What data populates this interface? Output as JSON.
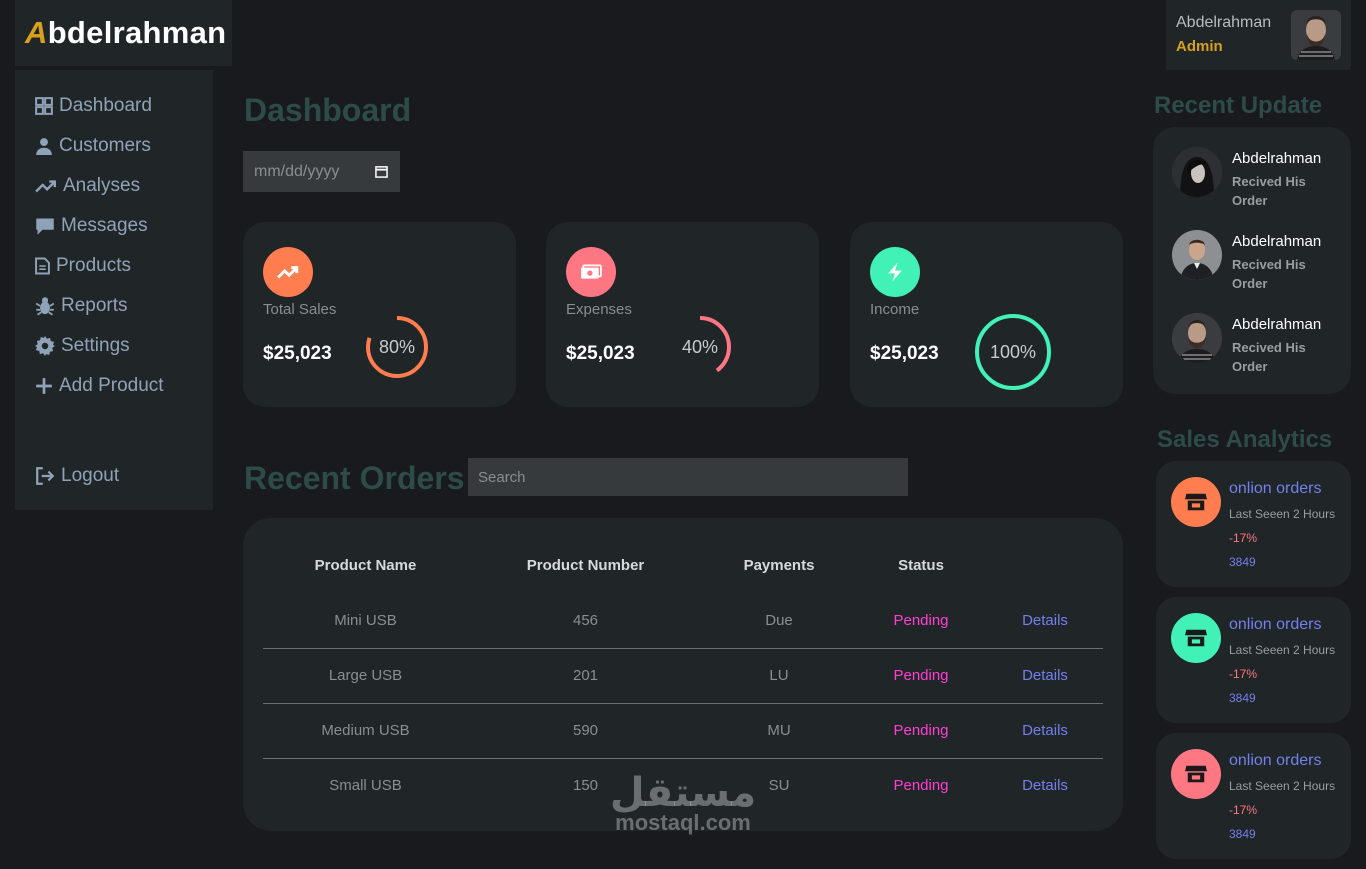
{
  "brand": {
    "first_letter": "A",
    "rest": "bdelrahman",
    "accent_color": "#d6a11c"
  },
  "topbar": {
    "user_name": "Abdelrahman",
    "user_role": "Admin"
  },
  "sidebar": {
    "items": [
      {
        "label": "Dashboard",
        "icon": "grid-icon"
      },
      {
        "label": "Customers",
        "icon": "person-icon"
      },
      {
        "label": "Analyses",
        "icon": "trend-icon"
      },
      {
        "label": "Messages",
        "icon": "message-icon"
      },
      {
        "label": "Products",
        "icon": "document-icon"
      },
      {
        "label": "Reports",
        "icon": "bug-icon"
      },
      {
        "label": "Settings",
        "icon": "gear-icon"
      },
      {
        "label": "Add Product",
        "icon": "plus-icon"
      }
    ],
    "logout": "Logout"
  },
  "main": {
    "title": "Dashboard",
    "date_placeholder": "mm/dd/yyyy",
    "cards": [
      {
        "label": "Total Sales",
        "value": "$25,023",
        "percent": "80%",
        "fraction": 0.8,
        "color": "#ff7d4f"
      },
      {
        "label": "Expenses",
        "value": "$25,023",
        "percent": "40%",
        "fraction": 0.4,
        "color": "#ff7782"
      },
      {
        "label": "Income",
        "value": "$25,023",
        "percent": "100%",
        "fraction": 1.0,
        "color": "#41f1b6"
      }
    ],
    "orders_title": "Recent Orders",
    "search_placeholder": "Search",
    "table": {
      "headers": [
        "Product Name",
        "Product Number",
        "Payments",
        "Status",
        ""
      ],
      "rows": [
        {
          "name": "Mini USB",
          "number": "456",
          "payment": "Due",
          "status": "Pending",
          "action": "Details"
        },
        {
          "name": "Large USB",
          "number": "201",
          "payment": "LU",
          "status": "Pending",
          "action": "Details"
        },
        {
          "name": "Medium USB",
          "number": "590",
          "payment": "MU",
          "status": "Pending",
          "action": "Details"
        },
        {
          "name": "Small USB",
          "number": "150",
          "payment": "SU",
          "status": "Pending",
          "action": "Details"
        }
      ]
    }
  },
  "right": {
    "updates_title": "Recent Update",
    "updates": [
      {
        "name": "Abdelrahman",
        "text": "Recived His Order"
      },
      {
        "name": "Abdelrahman",
        "text": "Recived His Order"
      },
      {
        "name": "Abdelrahman",
        "text": "Recived His Order"
      }
    ],
    "analytics_title": "Sales Analytics",
    "analytics": [
      {
        "title": "onlion orders",
        "seen": "Last Seeen 2 Hours",
        "percent": "-17%",
        "count": "3849",
        "color": "#ff7d4f"
      },
      {
        "title": "onlion orders",
        "seen": "Last Seeen 2 Hours",
        "percent": "-17%",
        "count": "3849",
        "color": "#41f1b6"
      },
      {
        "title": "onlion orders",
        "seen": "Last Seeen 2 Hours",
        "percent": "-17%",
        "count": "3849",
        "color": "#ff7782"
      }
    ]
  },
  "watermark": {
    "arabic": "مستقل",
    "latin": "mostaql.com"
  }
}
